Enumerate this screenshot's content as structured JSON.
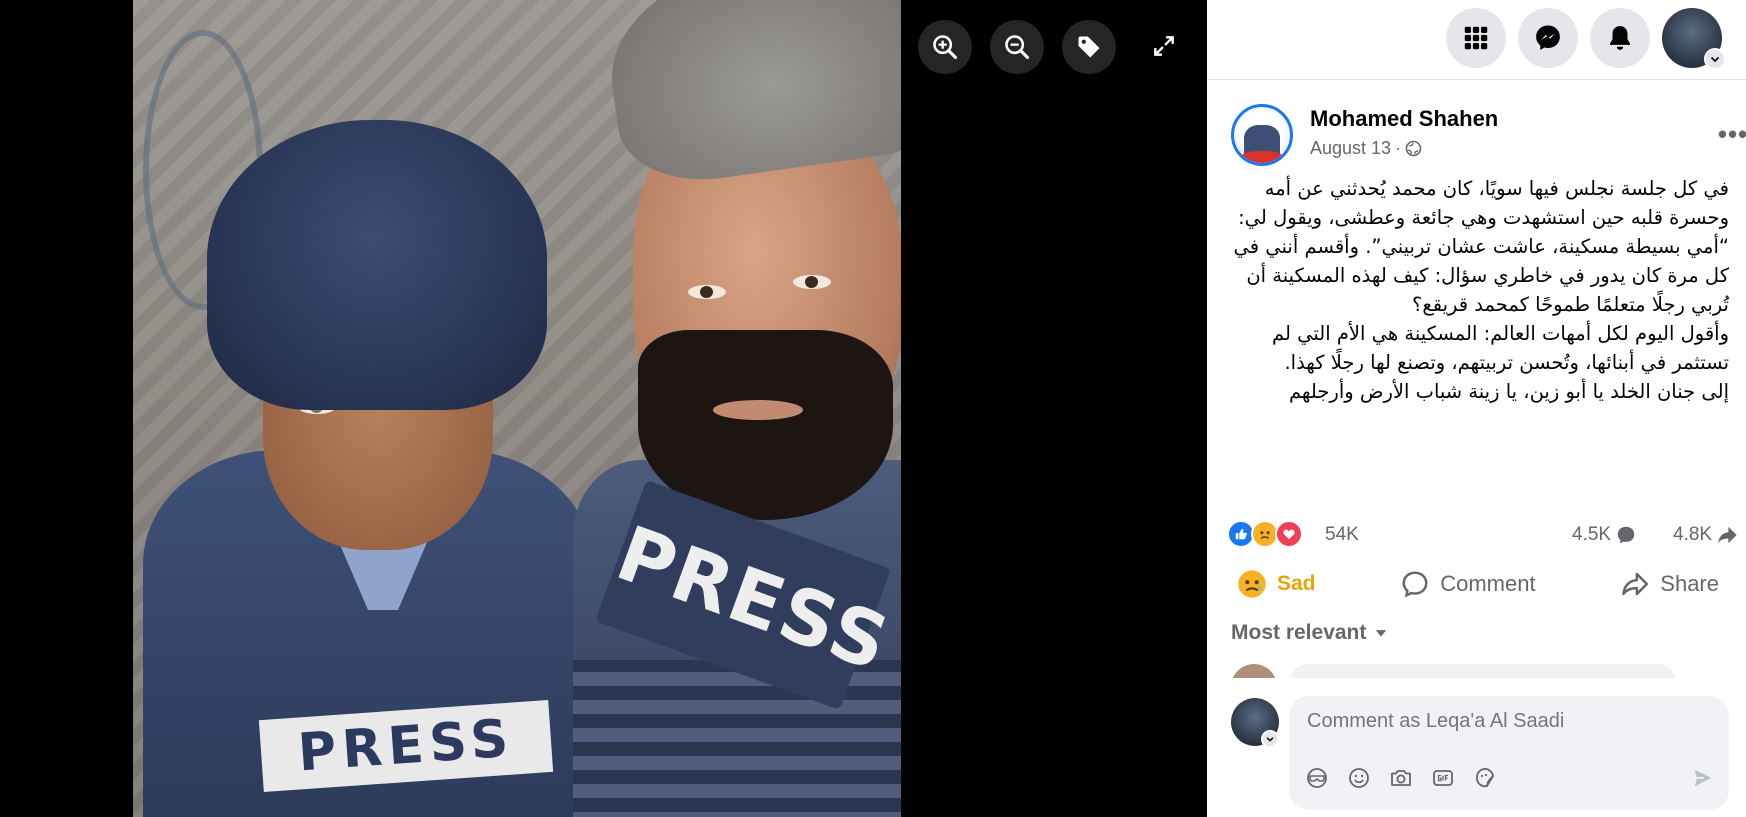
{
  "viewer": {
    "photo_alt": "",
    "patch_left": "PRESS",
    "patch_right": "PRESS",
    "buttons": [
      {
        "name": "zoom-in-icon"
      },
      {
        "name": "zoom-out-icon"
      },
      {
        "name": "tag-icon"
      },
      {
        "name": "fullscreen-icon"
      }
    ]
  },
  "topbar": {
    "icons": [
      "menu-grid-icon",
      "messenger-icon",
      "notifications-bell-icon",
      "profile-avatar"
    ]
  },
  "post": {
    "author": "Mohamed Shahen",
    "date": "August 13",
    "separator": "·",
    "audience_icon": "globe-icon",
    "more_label": "•••",
    "paragraphs": [
      "في كل جلسة نجلس فيها سويًا، كان محمد يُحدثني عن أمه وحسرة قلبه حين استشهدت وهي جائعة وعطشى، ويقول لي: “أمي بسيطة مسكينة، عاشت عشان تربيني”. وأقسم أنني في كل مرة كان يدور في خاطري سؤال: كيف لهذه المسكينة أن تُربي رجلًا متعلمًا طموحًا كمحمد قريقع؟",
      "وأقول اليوم لكل أمهات العالم: المسكينة هي الأم التي لم تستثمر في أبنائها، وتُحسن تربيتهم، وتصنع لها رجلًا كهذا.",
      "إلى جنان الخلد يا أبو زين، يا زينة شباب الأرض وأرجلهم"
    ]
  },
  "stats": {
    "reaction_icons": [
      "like",
      "sad",
      "love"
    ],
    "reactions": "54K",
    "comments": "4.5K",
    "shares": "4.8K"
  },
  "actions": {
    "sad": "Sad",
    "comment": "Comment",
    "share": "Share"
  },
  "comments": {
    "sort_label": "Most relevant",
    "input_placeholder": "Comment as Leqa'a Al Saadi",
    "tools": [
      "avatar-sticker-icon",
      "emoji-icon",
      "camera-icon",
      "gif-icon",
      "sticker-icon"
    ]
  },
  "colors": {
    "brand_blue": "#1877f2",
    "sad_yellow": "#e7a50a",
    "love_red": "#f33e58",
    "muted": "#65676b"
  }
}
